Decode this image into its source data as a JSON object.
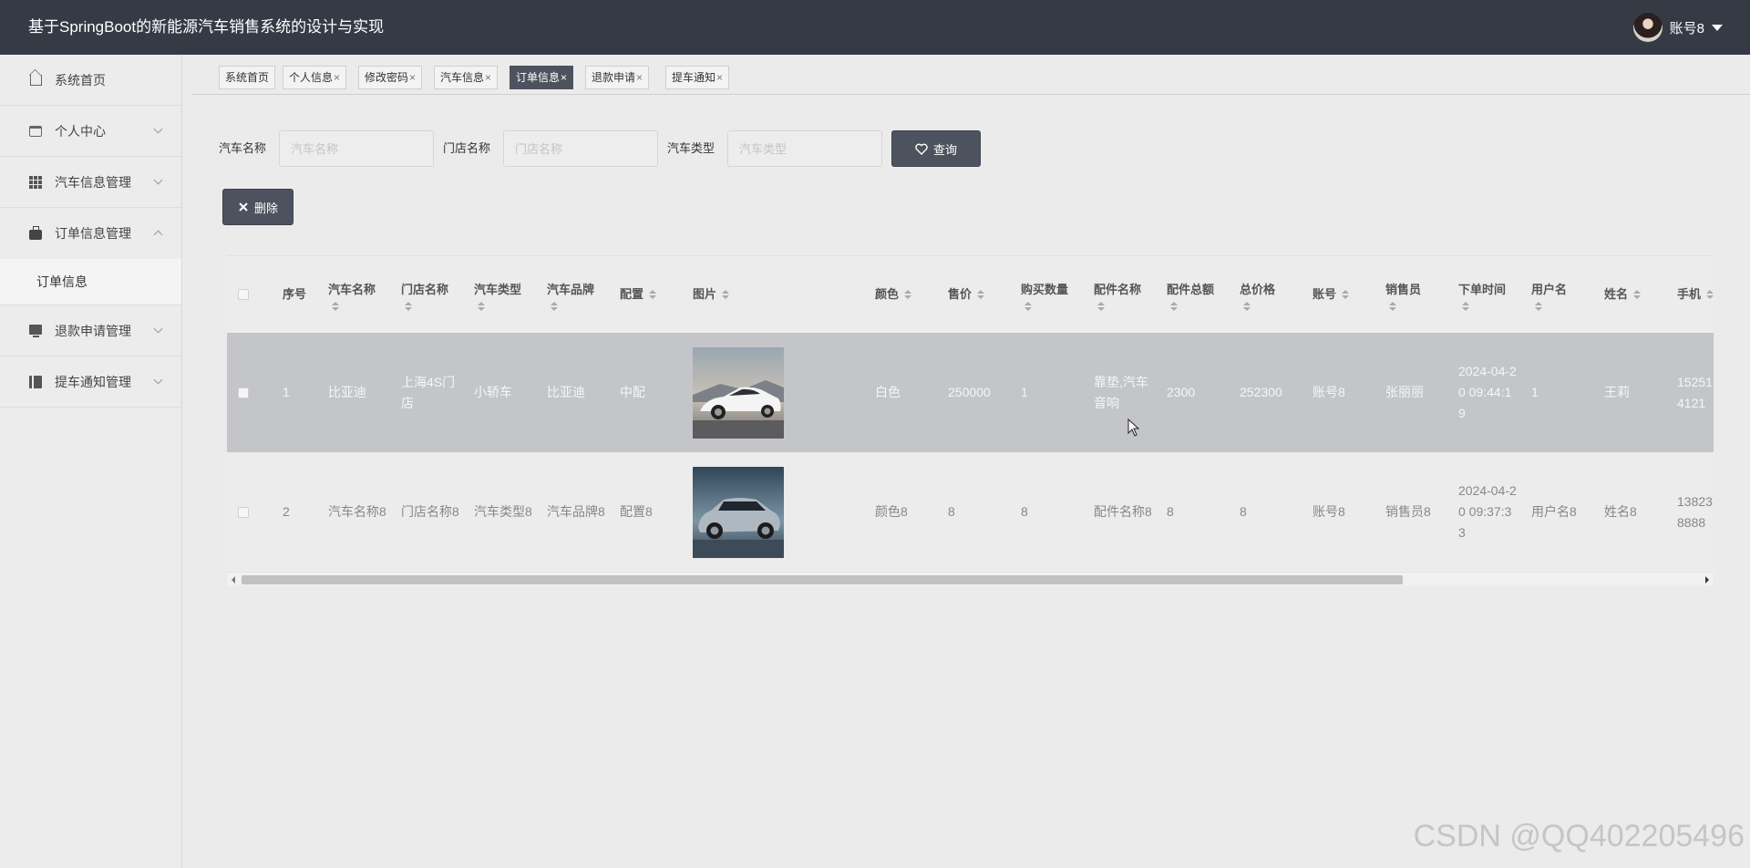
{
  "header": {
    "title": "基于SpringBoot的新能源汽车销售系统的设计与实现",
    "username": "账号8"
  },
  "sidebar": {
    "items": [
      {
        "label": "系统首页",
        "icon": "home-icon"
      },
      {
        "label": "个人中心",
        "icon": "card-icon"
      },
      {
        "label": "汽车信息管理",
        "icon": "grid-icon"
      },
      {
        "label": "订单信息管理",
        "icon": "briefcase-icon"
      },
      {
        "label": "退款申请管理",
        "icon": "monitor-icon"
      },
      {
        "label": "提车通知管理",
        "icon": "book-icon"
      }
    ],
    "submenu": {
      "label": "订单信息"
    }
  },
  "tabs": [
    {
      "label": "系统首页",
      "closable": false
    },
    {
      "label": "个人信息",
      "closable": true
    },
    {
      "label": "修改密码",
      "closable": true
    },
    {
      "label": "汽车信息",
      "closable": true
    },
    {
      "label": "订单信息",
      "closable": true,
      "active": true
    },
    {
      "label": "退款申请",
      "closable": true
    },
    {
      "label": "提车通知",
      "closable": true
    }
  ],
  "search": {
    "car_name_label": "汽车名称",
    "car_name_placeholder": "汽车名称",
    "store_name_label": "门店名称",
    "store_name_placeholder": "门店名称",
    "car_type_label": "汽车类型",
    "car_type_placeholder": "汽车类型",
    "query_button": "查询"
  },
  "actions": {
    "delete_button": "删除"
  },
  "table": {
    "columns": [
      {
        "line1": "序号",
        "line2": "",
        "sortable": false
      },
      {
        "line1": "汽车名称",
        "line2": "",
        "sortable": true
      },
      {
        "line1": "门店名称",
        "line2": "",
        "sortable": true
      },
      {
        "line1": "汽车类型",
        "line2": "",
        "sortable": true
      },
      {
        "line1": "汽车品牌",
        "line2": "",
        "sortable": true
      },
      {
        "line1": "配置",
        "line2": "",
        "sortable": true
      },
      {
        "line1": "图片",
        "line2": "",
        "sortable": true
      },
      {
        "line1": "颜色",
        "line2": "",
        "sortable": true
      },
      {
        "line1": "售价",
        "line2": "",
        "sortable": true
      },
      {
        "line1": "购买数量",
        "line2": "",
        "sortable": true
      },
      {
        "line1": "配件名称",
        "line2": "",
        "sortable": true
      },
      {
        "line1": "配件总额",
        "line2": "",
        "sortable": true
      },
      {
        "line1": "总价格",
        "line2": "",
        "sortable": true
      },
      {
        "line1": "账号",
        "line2": "",
        "sortable": true
      },
      {
        "line1": "销售员",
        "line2": "",
        "sortable": true
      },
      {
        "line1": "下单时间",
        "line2": "",
        "sortable": true
      },
      {
        "line1": "用户名",
        "line2": "",
        "sortable": true
      },
      {
        "line1": "姓名",
        "line2": "",
        "sortable": true
      },
      {
        "line1": "手机",
        "line2": "",
        "sortable": true
      }
    ],
    "rows": [
      {
        "index": "1",
        "car_name": "比亚迪",
        "store_name": "上海4S门店",
        "car_type": "小轿车",
        "brand": "比亚迪",
        "config": "中配",
        "image": "white-sports-car",
        "color": "白色",
        "price": "250000",
        "quantity": "1",
        "parts_name": "靠垫,汽车音响",
        "parts_total": "2300",
        "total_price": "252300",
        "account": "账号8",
        "salesperson": "张丽丽",
        "order_time": "2024-04-20 09:44:19",
        "username": "1",
        "name": "王莉",
        "phone": "152514121"
      },
      {
        "index": "2",
        "car_name": "汽车名称8",
        "store_name": "门店名称8",
        "car_type": "汽车类型8",
        "brand": "汽车品牌8",
        "config": "配置8",
        "image": "silver-suv",
        "color": "颜色8",
        "price": "8",
        "quantity": "8",
        "parts_name": "配件名称8",
        "parts_total": "8",
        "total_price": "8",
        "account": "账号8",
        "salesperson": "销售员8",
        "order_time": "2024-04-20 09:37:33",
        "username": "用户名8",
        "name": "姓名8",
        "phone": "138238888"
      }
    ]
  },
  "watermark": "CSDN @QQ402205496",
  "colors": {
    "header_bg": "#353b45",
    "active_tab": "#4d535e",
    "button_dark": "#4d535e",
    "hover_row": "#c3c5c8"
  }
}
